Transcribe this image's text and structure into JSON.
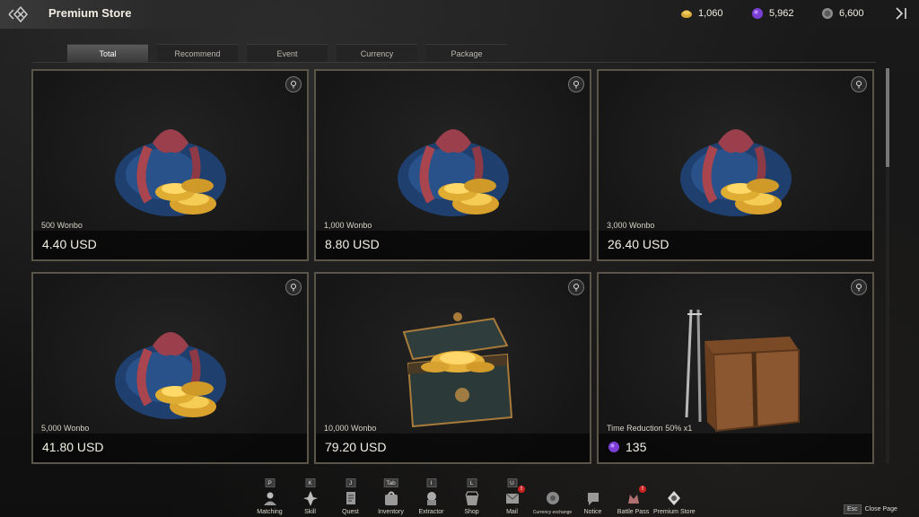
{
  "header": {
    "title": "Premium Store",
    "currencies": [
      {
        "name": "wonbo-gold",
        "value": "1,060",
        "color": "#d9a93a"
      },
      {
        "name": "purple-gem",
        "value": "5,962",
        "color": "#8a4ae0"
      },
      {
        "name": "silver-coin",
        "value": "6,600",
        "color": "#aaaaaa"
      }
    ]
  },
  "tabs": [
    {
      "label": "Total",
      "active": true
    },
    {
      "label": "Recommend",
      "active": false
    },
    {
      "label": "Event",
      "active": false
    },
    {
      "label": "Currency",
      "active": false
    },
    {
      "label": "Package",
      "active": false
    }
  ],
  "products": [
    {
      "name": "500 Wonbo",
      "price": "4.40 USD",
      "art": "wonbo-bag-icon"
    },
    {
      "name": "1,000 Wonbo",
      "price": "8.80 USD",
      "art": "wonbo-bag-icon"
    },
    {
      "name": "3,000 Wonbo",
      "price": "26.40 USD",
      "art": "wonbo-bag-icon"
    },
    {
      "name": "5,000 Wonbo",
      "price": "41.80 USD",
      "art": "wonbo-bag-icon"
    },
    {
      "name": "10,000 Wonbo",
      "price": "79.20 USD",
      "art": "treasure-chest-icon"
    },
    {
      "name": "Time Reduction 50% x1",
      "price": "135",
      "art": "crate-icon",
      "price_currency": "purple-gem"
    }
  ],
  "bottom_nav": [
    {
      "key": "P",
      "label": "Matching",
      "icon": "matching-icon"
    },
    {
      "key": "K",
      "label": "Skill",
      "icon": "skill-icon"
    },
    {
      "key": "J",
      "label": "Quest",
      "icon": "quest-icon"
    },
    {
      "key": "Tab",
      "label": "Inventory",
      "icon": "inventory-icon"
    },
    {
      "key": "I",
      "label": "Extractor",
      "icon": "extractor-icon"
    },
    {
      "key": "L",
      "label": "Shop",
      "icon": "shop-icon"
    },
    {
      "key": "U",
      "label": "Mail",
      "icon": "mail-icon",
      "alert": "!"
    },
    {
      "key": "",
      "label": "Currency exchange",
      "icon": "currency-exchange-icon"
    },
    {
      "key": "",
      "label": "Notice",
      "icon": "notice-icon"
    },
    {
      "key": "",
      "label": "Battle Pass",
      "icon": "battle-pass-icon",
      "alert": "!"
    },
    {
      "key": "",
      "label": "Premium Store",
      "icon": "premium-store-icon"
    }
  ],
  "footer": {
    "esc_key": "Esc",
    "close_label": "Close Page"
  }
}
